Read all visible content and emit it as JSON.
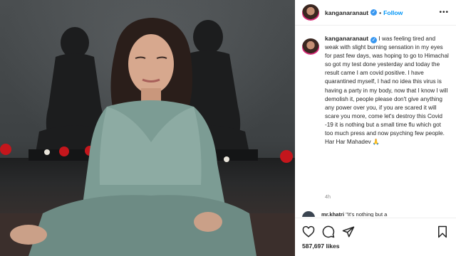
{
  "post": {
    "username": "kanganaranaut",
    "separator": "•",
    "follow_label": "Follow",
    "caption": "I was feeling tired and weak with slight burning sensation in my eyes for past few days, was hoping to go to Himachal so got my test done yesterday and today the result came I am covid positive. I have quarantined myself, I had no idea this virus is having a party in my body, now that I know I will demolish it, people please don't give anything any power over you, if you are scared it will scare you more, come let's destroy this Covid -19 it is nothing but a small time flu which got too much press and now psyching few people. Har Har Mahadev 🙏",
    "timestamp": "4h",
    "likes": "587,697 likes"
  },
  "comment_preview": {
    "username": "mr.khatri",
    "text": "\"It's nothing but a"
  },
  "icons": {
    "verified": "verified-badge-icon",
    "more": "more-options-icon",
    "like": "heart-icon",
    "comment": "comment-icon",
    "share": "share-icon",
    "save": "bookmark-icon"
  },
  "colors": {
    "accent": "#0095f6",
    "verified": "#3897f0",
    "muted": "#8e8e8e",
    "text": "#262626"
  }
}
